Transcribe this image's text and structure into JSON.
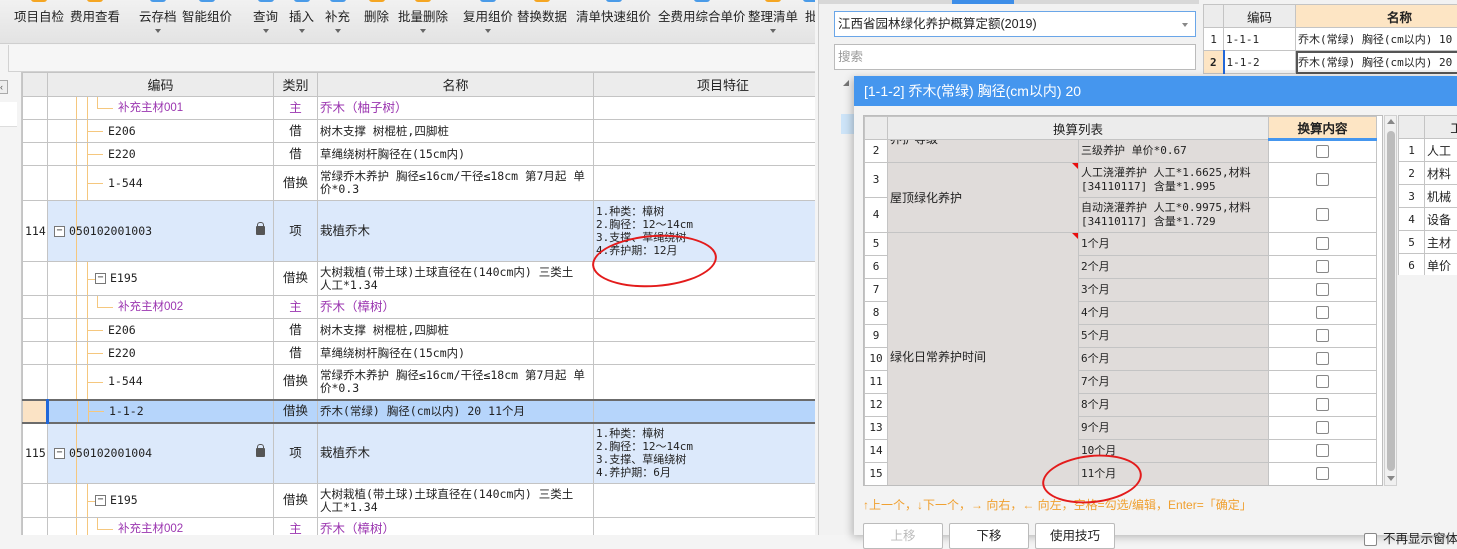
{
  "toolbar": {
    "buttons": [
      {
        "label": "项目自检",
        "dropdown": false
      },
      {
        "label": "费用查看",
        "dropdown": false
      },
      {
        "label": "云存档",
        "dropdown": true
      },
      {
        "label": "智能组价",
        "dropdown": false
      },
      {
        "label": "查询",
        "dropdown": true
      },
      {
        "label": "插入",
        "dropdown": true
      },
      {
        "label": "补充",
        "dropdown": true
      },
      {
        "label": "删除",
        "dropdown": false
      },
      {
        "label": "批量删除",
        "dropdown": true
      },
      {
        "label": "复用组价",
        "dropdown": true
      },
      {
        "label": "替换数据",
        "dropdown": false
      },
      {
        "label": "清单快速组价",
        "dropdown": false
      },
      {
        "label": "全费用综合单价",
        "dropdown": false
      },
      {
        "label": "整理清单",
        "dropdown": true
      },
      {
        "label": "批",
        "dropdown": false
      }
    ]
  },
  "main_grid": {
    "columns": [
      "",
      "编码",
      "类别",
      "名称",
      "项目特征"
    ],
    "rows": [
      {
        "num": "",
        "code": "补充主材001",
        "type": "主",
        "name": "乔木（柚子树）",
        "feature": "",
        "style": "material"
      },
      {
        "num": "",
        "code": "E206",
        "type": "借",
        "name": "树木支撑 树棍桩,四脚桩",
        "feature": "",
        "style": "sub"
      },
      {
        "num": "",
        "code": "E220",
        "type": "借",
        "name": "草绳绕树杆胸径在(15cm内)",
        "feature": "",
        "style": "sub"
      },
      {
        "num": "",
        "code": "1-544",
        "type": "借换",
        "name": "常绿乔木养护 胸径≤16cm/干径≤18cm  第7月起 单价*0.3",
        "feature": "",
        "style": "sub2"
      },
      {
        "num": "114",
        "code": "050102001003",
        "type": "项",
        "name": "栽植乔木",
        "feature": "1.种类：樟树\n2.胸径：12～14cm\n3.支撑、草绳绕树\n4.养护期：12月",
        "style": "item",
        "locked": true
      },
      {
        "num": "",
        "code": "E195",
        "type": "借换",
        "name": "大树栽植(带土球)土球直径在(140cm内)  三类土 人工*1.34",
        "feature": "",
        "style": "parent"
      },
      {
        "num": "",
        "code": "补充主材002",
        "type": "主",
        "name": "乔木（樟树）",
        "feature": "",
        "style": "material"
      },
      {
        "num": "",
        "code": "E206",
        "type": "借",
        "name": "树木支撑 树棍桩,四脚桩",
        "feature": "",
        "style": "sub"
      },
      {
        "num": "",
        "code": "E220",
        "type": "借",
        "name": "草绳绕树杆胸径在(15cm内)",
        "feature": "",
        "style": "sub"
      },
      {
        "num": "",
        "code": "1-544",
        "type": "借换",
        "name": "常绿乔木养护 胸径≤16cm/干径≤18cm  第7月起 单价*0.3",
        "feature": "",
        "style": "sub2"
      },
      {
        "num": "",
        "code": "1-1-2",
        "type": "借换",
        "name": "乔木(常绿) 胸径(cm以内) 20  11个月",
        "feature": "",
        "style": "selected"
      },
      {
        "num": "115",
        "code": "050102001004",
        "type": "项",
        "name": "栽植乔木",
        "feature": "1.种类：樟树\n2.胸径：12～14cm\n3.支撑、草绳绕树\n4.养护期：6月",
        "style": "item",
        "locked": true
      },
      {
        "num": "",
        "code": "E195",
        "type": "借换",
        "name": "大树栽植(带土球)土球直径在(140cm内)  三类土 人工*1.34",
        "feature": "",
        "style": "parent"
      },
      {
        "num": "",
        "code": "补充主材002",
        "type": "主",
        "name": "乔木（樟树）",
        "feature": "",
        "style": "material"
      }
    ]
  },
  "right_panel": {
    "library_select": "江西省园林绿化养护概算定额(2019)",
    "search_placeholder": "搜索",
    "ref_grid": {
      "columns": [
        "",
        "编码",
        "名称"
      ],
      "rows": [
        {
          "num": "1",
          "code": "1-1-1",
          "name": "乔木(常绿) 胸径(cm以内) 10"
        },
        {
          "num": "2",
          "code": "1-1-2",
          "name": "乔木(常绿) 胸径(cm以内) 20"
        }
      ]
    }
  },
  "dialog": {
    "title": "[1-1-2] 乔木(常绿) 胸径(cm以内) 20",
    "conv_table": {
      "header_list": "换算列表",
      "header_content": "换算内容",
      "partial_group_top": "养护等级",
      "rows": [
        {
          "num": "2",
          "option": "三级养护 单价*0.67",
          "checked": false
        },
        {
          "num": "3",
          "option": "人工浇灌养护 人工*1.6625,材料[34110117] 含量*1.995",
          "checked": false
        },
        {
          "num": "4",
          "option": "自动浇灌养护 人工*0.9975,材料[34110117] 含量*1.729",
          "checked": false
        },
        {
          "num": "5",
          "option": "1个月",
          "checked": false
        },
        {
          "num": "6",
          "option": "2个月",
          "checked": false
        },
        {
          "num": "7",
          "option": "3个月",
          "checked": false
        },
        {
          "num": "8",
          "option": "4个月",
          "checked": false
        },
        {
          "num": "9",
          "option": "5个月",
          "checked": false
        },
        {
          "num": "10",
          "option": "6个月",
          "checked": false
        },
        {
          "num": "11",
          "option": "7个月",
          "checked": false
        },
        {
          "num": "12",
          "option": "8个月",
          "checked": false
        },
        {
          "num": "13",
          "option": "9个月",
          "checked": false
        },
        {
          "num": "14",
          "option": "10个月",
          "checked": false
        },
        {
          "num": "15",
          "option": "11个月",
          "checked": false
        }
      ],
      "groups": [
        {
          "label": "屋顶绿化养护"
        },
        {
          "label": "绿化日常养护时间"
        }
      ]
    },
    "resource_grid": {
      "header": "工",
      "rows": [
        {
          "num": "1",
          "label": "人工"
        },
        {
          "num": "2",
          "label": "材料"
        },
        {
          "num": "3",
          "label": "机械"
        },
        {
          "num": "4",
          "label": "设备"
        },
        {
          "num": "5",
          "label": "主材"
        },
        {
          "num": "6",
          "label": "单价"
        }
      ]
    },
    "hint": "↑上一个，↓下一个，→ 向右，← 向左，空格=勾选/编辑，Enter=「确定」",
    "buttons": {
      "prev": "上移",
      "next": "下移",
      "tips": "使用技巧"
    },
    "no_show_label": "不再显示窗体"
  }
}
